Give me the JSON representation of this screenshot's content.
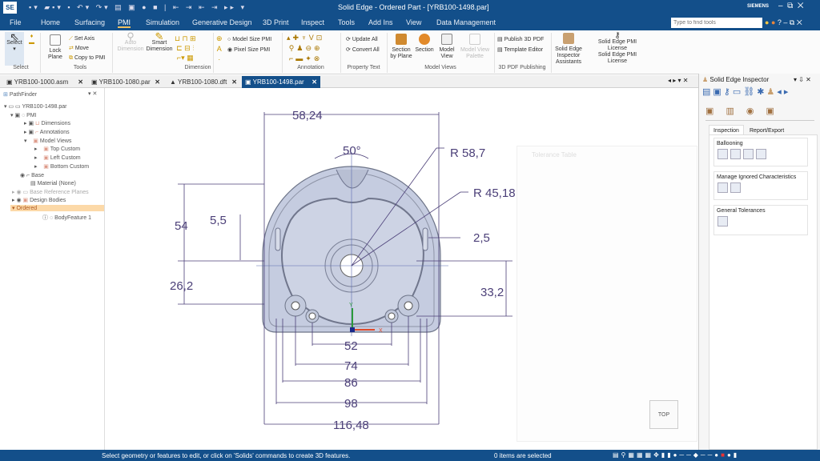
{
  "app": {
    "logo": "SE",
    "title": "Solid Edge - Ordered Part - [YRB100-1498.par]",
    "brand": "SIEMENS"
  },
  "menu": [
    "File",
    "Home",
    "Surfacing",
    "PMI",
    "Simulation",
    "Generative Design",
    "3D Print",
    "Inspect",
    "Tools",
    "Add Ins",
    "View",
    "Data Management"
  ],
  "search": {
    "placeholder": "Type to find tools"
  },
  "ribbon": {
    "select": "Select",
    "select_group": "Select",
    "lock_plane": "Lock Plane",
    "set_axis": "Set Axis",
    "move": "Move",
    "copy_to_pmi": "Copy to PMI",
    "tools_group": "Tools",
    "auto_dimension": "Auto Dimension",
    "smart_dimension": "Smart Dimension",
    "dimension_group": "Dimension",
    "model_size_pmi": "Model Size PMI",
    "pixel_size_pmi": "Pixel Size PMI",
    "annotation_group": "Annotation",
    "update_all": "Update All",
    "convert_all": "Convert All",
    "property_text_group": "Property Text",
    "section_by_plane": "Section by Plane",
    "section": "Section",
    "model_view": "Model View",
    "model_view_palette": "Model View Palette",
    "model_views_group": "Model Views",
    "publish_3d_pdf": "Publish 3D PDF",
    "template_editor": "Template Editor",
    "pdf_group": "3D PDF Publishing",
    "inspector_assistants": "Solid Edge Inspector Assistants",
    "pmi_license": "Solid Edge PMI License",
    "pmi_license_group": "Solid Edge PMI License"
  },
  "doc_tabs": [
    "YRB100-1000.asm",
    "YRB100-1080.par",
    "YRB100-1080.dft",
    "YRB100-1498.par"
  ],
  "pathfinder": {
    "title": "PathFinder",
    "items": [
      "YRB100-1498.par",
      "PMI",
      "Dimensions",
      "Annotations",
      "Model Views",
      "Top Custom",
      "Left Custom",
      "Bottom Custom",
      "Base",
      "Material (None)",
      "Base Reference Planes",
      "Design Bodies",
      "Ordered",
      "BodyFeature 1"
    ]
  },
  "drawing": {
    "dims": [
      "58,24",
      "50°",
      "R 58,7",
      "R 45,18",
      "54",
      "5,5",
      "2,5",
      "26,2",
      "33,2",
      "52",
      "74",
      "86",
      "98",
      "116,48"
    ],
    "floating_dialog": "Tolerance Table",
    "view_cube": "TOP",
    "axis_x": "X",
    "axis_y": "Y"
  },
  "inspector": {
    "title": "Solid Edge Inspector",
    "tabs": [
      "Inspection",
      "Report/Export"
    ],
    "sections": [
      "Ballooning",
      "Manage Ignored Characteristics",
      "General Tolerances"
    ]
  },
  "status": {
    "prompt": "Select geometry or features to edit, or click on 'Solids' commands to create 3D features.",
    "selection": "0 items are selected"
  },
  "colors": {
    "brand_blue": "#134f8a",
    "dimension": "#4b3f78",
    "part": "#c5cce0",
    "selected_row": "#fcd9a8"
  }
}
